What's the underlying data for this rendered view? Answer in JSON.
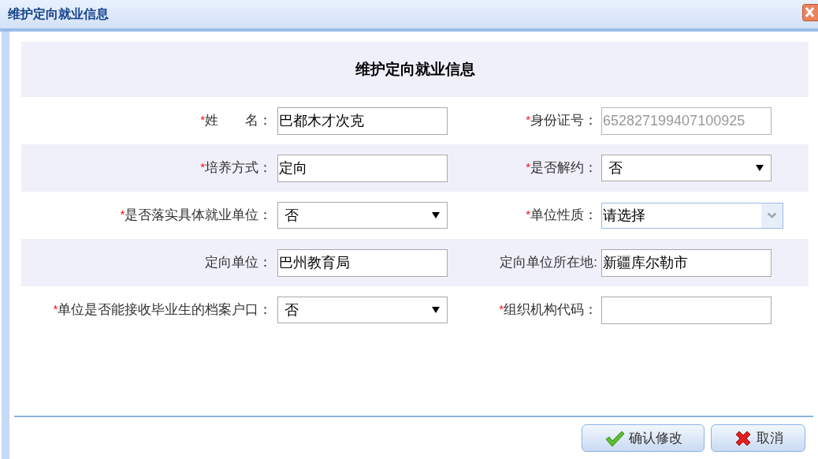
{
  "window": {
    "title": "维护定向就业信息"
  },
  "form": {
    "heading": "维护定向就业信息",
    "rows": [
      [
        {
          "marker": "*",
          "label": "姓　　名：",
          "kind": "text",
          "value": "巴都木才次克",
          "disabled": false
        },
        {
          "marker": "*",
          "label": "身份证号：",
          "kind": "text",
          "value": "652827199407100925",
          "disabled": true
        }
      ],
      [
        {
          "marker": "*",
          "label": "培养方式：",
          "kind": "text",
          "value": "定向",
          "disabled": false
        },
        {
          "marker": "*",
          "label": "是否解约：",
          "kind": "select",
          "value": "否",
          "disabled": false
        }
      ],
      [
        {
          "marker": "*",
          "label": "是否落实具体就业单位：",
          "kind": "select",
          "value": "否",
          "disabled": false
        },
        {
          "marker": "*",
          "label": "单位性质：",
          "kind": "combo",
          "value": "请选择",
          "disabled": false
        }
      ],
      [
        {
          "label": "定向单位：",
          "kind": "text",
          "value": "巴州教育局",
          "disabled": false
        },
        {
          "label": "定向单位所在地:",
          "kind": "text",
          "value": "新疆库尔勒市",
          "disabled": false
        }
      ],
      [
        {
          "marker": "*",
          "label": "单位是否能接收毕业生的档案户口：",
          "kind": "select",
          "value": "否",
          "disabled": false
        },
        {
          "marker": "*",
          "label": "组织机构代码：",
          "kind": "text",
          "disabled": false
        }
      ]
    ]
  },
  "buttons": [
    {
      "kind": "confirm",
      "label": "确认修改"
    },
    {
      "kind": "cancel",
      "label": "取消"
    }
  ]
}
